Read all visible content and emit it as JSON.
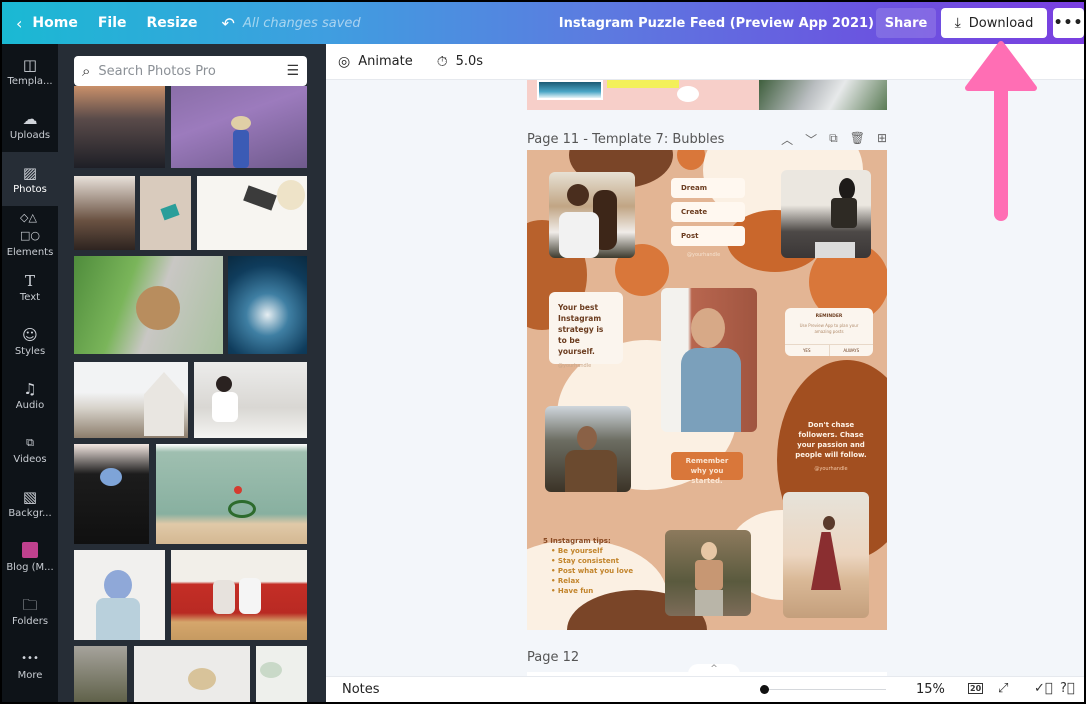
{
  "topbar": {
    "home_label": "Home",
    "file_label": "File",
    "resize_label": "Resize",
    "save_status": "All changes saved",
    "design_title": "Instagram Puzzle Feed (Preview App 2021)",
    "share_label": "Share",
    "download_label": "Download",
    "more_label": "•••"
  },
  "sidebar": {
    "items": [
      {
        "label": "Templa...",
        "icon": "template-icon",
        "glyph": "◫"
      },
      {
        "label": "Uploads",
        "icon": "cloud-upload-icon",
        "glyph": "☁"
      },
      {
        "label": "Photos",
        "icon": "image-icon",
        "glyph": "▨",
        "active": true
      },
      {
        "label": "Elements",
        "icon": "shapes-icon",
        "glyph": "◇△"
      },
      {
        "label": "Text",
        "icon": "text-icon",
        "glyph": "T"
      },
      {
        "label": "Styles",
        "icon": "palette-icon",
        "glyph": "☺"
      },
      {
        "label": "Audio",
        "icon": "music-note-icon",
        "glyph": "♫"
      },
      {
        "label": "Videos",
        "icon": "video-icon",
        "glyph": "▶"
      },
      {
        "label": "Backgr...",
        "icon": "background-pattern-icon",
        "glyph": "▨"
      },
      {
        "label": "Blog (M...",
        "icon": "folder-swatch-icon",
        "color": "#c0418e"
      },
      {
        "label": "Folders",
        "icon": "folder-icon",
        "glyph": "▭"
      },
      {
        "label": "More",
        "icon": "more-dots-icon",
        "glyph": "•••"
      }
    ]
  },
  "photos_panel": {
    "search_placeholder": "Search Photos Pro",
    "photos": [
      "city-skyline-dusk",
      "lavender-field-woman-hat",
      "woman-curly-hair",
      "cosmetics-flatlay",
      "laptop-flatlay",
      "pug-on-lap",
      "ocean-aerial-waves",
      "ferris-wheel-houses",
      "office-team-desk",
      "woman-holding-flowers",
      "child-on-bike",
      "woman-flowers-face",
      "couple-cooking-kitchen",
      "plant-shop",
      "brunch-table",
      "food-flatlay"
    ]
  },
  "editor_toolbar": {
    "animate_label": "Animate",
    "duration_label": "5.0s"
  },
  "pages": {
    "current_title": "Page 11 - Template 7: Bubbles",
    "next_title": "Page 12"
  },
  "template": {
    "chips": [
      "Dream",
      "Create",
      "Post"
    ],
    "handle": "@yourhandle",
    "quote_left": "Your best Instagram strategy is to be yourself.",
    "reminder_title": "REMINDER",
    "reminder_body": "Use Preview App to plan your amazing posts",
    "reminder_yes": "YES",
    "reminder_always": "ALWAYS",
    "quote_right": "Don't chase followers. Chase your passion and people will follow.",
    "remember": "Remember why you started.",
    "tips_title": "5 Instagram tips:",
    "tips": [
      "Be yourself",
      "Stay consistent",
      "Post what you love",
      "Relax",
      "Have fun"
    ]
  },
  "bottombar": {
    "notes_label": "Notes",
    "zoom_value": "15%",
    "zoom_fraction": 0.0,
    "page_count": "20"
  },
  "colors": {
    "accent_pink_arrow": "#ff6eb4",
    "template_bg": "#e3b594",
    "template_brown": "#7a4528",
    "template_orange": "#d9773a"
  }
}
